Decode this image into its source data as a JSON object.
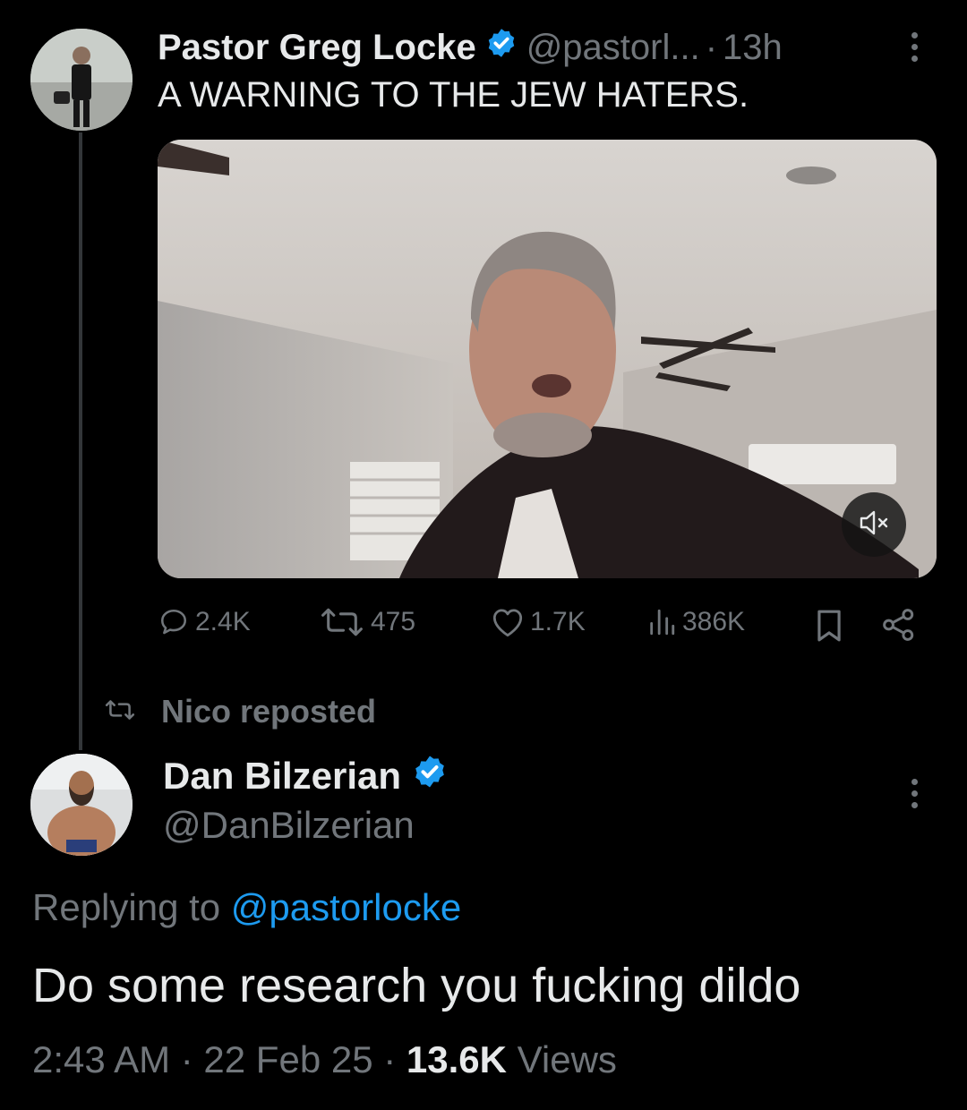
{
  "tweet1": {
    "author_name": "Pastor Greg Locke",
    "handle": "@pastorl...",
    "separator": "·",
    "time": "13h",
    "text": "A WARNING TO THE JEW HATERS.",
    "stats": {
      "replies": "2.4K",
      "reposts": "475",
      "likes": "1.7K",
      "views": "386K"
    }
  },
  "repost_banner": {
    "text": "Nico reposted"
  },
  "tweet2": {
    "author_name": "Dan Bilzerian",
    "handle": "@DanBilzerian",
    "replying_prefix": "Replying to",
    "replying_handle": "@pastorlocke",
    "text": "Do some research you fucking dildo",
    "timestamp": "2:43 AM · 22 Feb 25 ·",
    "views_count": "13.6K",
    "views_label": "Views"
  },
  "icons": [
    "verified-badge-icon",
    "more-icon",
    "mute-icon",
    "reply-icon",
    "repost-icon",
    "like-icon",
    "views-icon",
    "bookmark-icon",
    "share-icon"
  ],
  "colors": {
    "background": "#000000",
    "text": "#e7e9ea",
    "muted": "#71767b",
    "link": "#1d9bf0",
    "verified": "#1d9bf0"
  }
}
